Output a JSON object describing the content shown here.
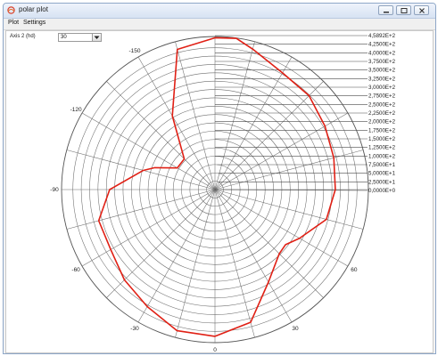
{
  "window": {
    "title": "polar plot",
    "menu": [
      "Plot",
      "Settings"
    ]
  },
  "toolbar": {
    "axis_label": "Axis 2 (hd)",
    "axis_value": "30"
  },
  "chart_data": {
    "type": "polar",
    "angle_labels": [
      {
        "deg": 180,
        "text": "-180 / 180"
      },
      {
        "deg": -150,
        "text": "-150"
      },
      {
        "deg": -120,
        "text": "-120"
      },
      {
        "deg": -90,
        "text": "-90"
      },
      {
        "deg": -60,
        "text": "-60"
      },
      {
        "deg": -30,
        "text": "-30"
      },
      {
        "deg": 0,
        "text": "0"
      },
      {
        "deg": 30,
        "text": "30"
      },
      {
        "deg": 60,
        "text": "60"
      }
    ],
    "radial_ticks": [
      {
        "value": 458.92,
        "text": "4,5892E+2"
      },
      {
        "value": 425,
        "text": "4,2500E+2"
      },
      {
        "value": 400,
        "text": "4,0000E+2"
      },
      {
        "value": 375,
        "text": "3,7500E+2"
      },
      {
        "value": 350,
        "text": "3,5000E+2"
      },
      {
        "value": 325,
        "text": "3,2500E+2"
      },
      {
        "value": 300,
        "text": "3,0000E+2"
      },
      {
        "value": 275,
        "text": "2,7500E+2"
      },
      {
        "value": 250,
        "text": "2,5000E+2"
      },
      {
        "value": 225,
        "text": "2,2500E+2"
      },
      {
        "value": 200,
        "text": "2,0000E+2"
      },
      {
        "value": 175,
        "text": "1,7500E+2"
      },
      {
        "value": 150,
        "text": "1,5000E+2"
      },
      {
        "value": 125,
        "text": "1,2500E+2"
      },
      {
        "value": 100,
        "text": "1,0000E+2"
      },
      {
        "value": 75,
        "text": "7,5000E+1"
      },
      {
        "value": 50,
        "text": "5,0000E+1"
      },
      {
        "value": 25,
        "text": "2,5000E+1"
      },
      {
        "value": 0,
        "text": "0,0000E+0"
      }
    ],
    "rmax": 458.92,
    "spoke_step_deg": 15,
    "grid": true,
    "series": [
      {
        "color": "#e02015",
        "points": [
          [
            0,
            440
          ],
          [
            15,
            412
          ],
          [
            30,
            320
          ],
          [
            45,
            272
          ],
          [
            52,
            268
          ],
          [
            60,
            292
          ],
          [
            75,
            345
          ],
          [
            90,
            360
          ],
          [
            105,
            368
          ],
          [
            120,
            380
          ],
          [
            135,
            398
          ],
          [
            150,
            404
          ],
          [
            165,
            436
          ],
          [
            172,
            458
          ],
          [
            180,
            455
          ],
          [
            -165,
            435
          ],
          [
            -150,
            255
          ],
          [
            -135,
            130
          ],
          [
            -120,
            130
          ],
          [
            -110,
            192
          ],
          [
            -105,
            222
          ],
          [
            -90,
            315
          ],
          [
            -75,
            360
          ],
          [
            -60,
            360
          ],
          [
            -45,
            383
          ],
          [
            -30,
            405
          ],
          [
            -15,
            438
          ],
          [
            0,
            440
          ]
        ]
      }
    ]
  }
}
